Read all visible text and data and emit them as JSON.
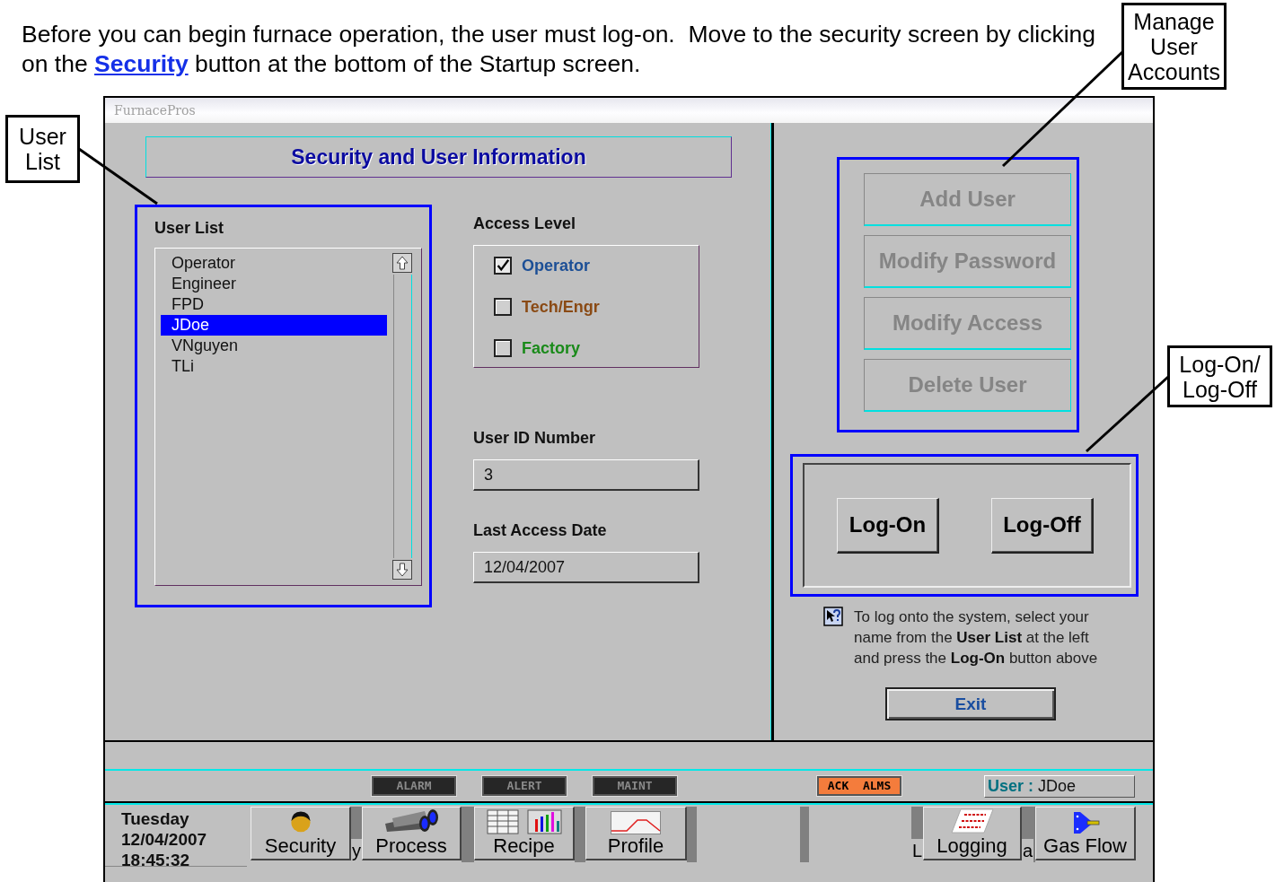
{
  "intro": {
    "before": "Before you can begin furnace operation, the user must log-on.  Move to the security screen by clicking on the ",
    "link": "Security",
    "after": " button at the bottom of the Startup screen."
  },
  "callouts": [
    {
      "text": "User List"
    },
    {
      "text": "Manage User Accounts"
    },
    {
      "text": "Log-On/ Log-Off"
    }
  ],
  "window": {
    "title": "FurnacePros",
    "header": "Security and User Information"
  },
  "user_list": {
    "label": "User List",
    "items": [
      {
        "name": "Operator",
        "selected": false
      },
      {
        "name": "Engineer",
        "selected": false
      },
      {
        "name": "FPD",
        "selected": false
      },
      {
        "name": "JDoe",
        "selected": true
      },
      {
        "name": "VNguyen",
        "selected": false
      },
      {
        "name": "TLi",
        "selected": false
      }
    ]
  },
  "access_level": {
    "label": "Access Level",
    "options": [
      {
        "label": "Operator",
        "checked": true,
        "color": "#1c4f96"
      },
      {
        "label": "Tech/Engr",
        "checked": false,
        "color": "#8a4a14"
      },
      {
        "label": "Factory",
        "checked": false,
        "color": "#1a8a1a"
      }
    ]
  },
  "user_id": {
    "label": "User ID Number",
    "value": "3"
  },
  "last_access": {
    "label": "Last Access Date",
    "value": "12/04/2007"
  },
  "account_buttons": [
    {
      "label": "Add User",
      "disabled": true
    },
    {
      "label": "Modify Password",
      "disabled": true
    },
    {
      "label": "Modify Access",
      "disabled": true
    },
    {
      "label": "Delete User",
      "disabled": true
    }
  ],
  "log_buttons": [
    {
      "label": "Log-On"
    },
    {
      "label": "Log-Off"
    }
  ],
  "help": "To log onto the system, select your name from the **User List**  at the left and press the **Log-On** button above",
  "exit": "Exit",
  "indicators": [
    {
      "label": "ALARM",
      "active": false
    },
    {
      "label": "ALERT",
      "active": false
    },
    {
      "label": "MAINT",
      "active": false
    },
    {
      "label": "ACK  ALMS",
      "active": true
    }
  ],
  "user_field": {
    "label": "User :",
    "value": "JDoe"
  },
  "clock": {
    "day": "Tuesday",
    "date": "12/04/2007",
    "time": "18:45:32"
  },
  "nav": [
    {
      "kind": "button",
      "label": "Security"
    },
    {
      "kind": "gap",
      "fragment": "y"
    },
    {
      "kind": "button",
      "label": "Process"
    },
    {
      "kind": "gap"
    },
    {
      "kind": "button",
      "label": "Recipe"
    },
    {
      "kind": "gap"
    },
    {
      "kind": "button",
      "label": "Profile"
    },
    {
      "kind": "gap"
    },
    {
      "kind": "empty"
    },
    {
      "kind": "gap"
    },
    {
      "kind": "empty"
    },
    {
      "kind": "gap",
      "fragment": "L"
    },
    {
      "kind": "button",
      "label": "Logging"
    },
    {
      "kind": "gap",
      "fragment": "a"
    },
    {
      "kind": "button",
      "label": "Gas Flow"
    }
  ]
}
